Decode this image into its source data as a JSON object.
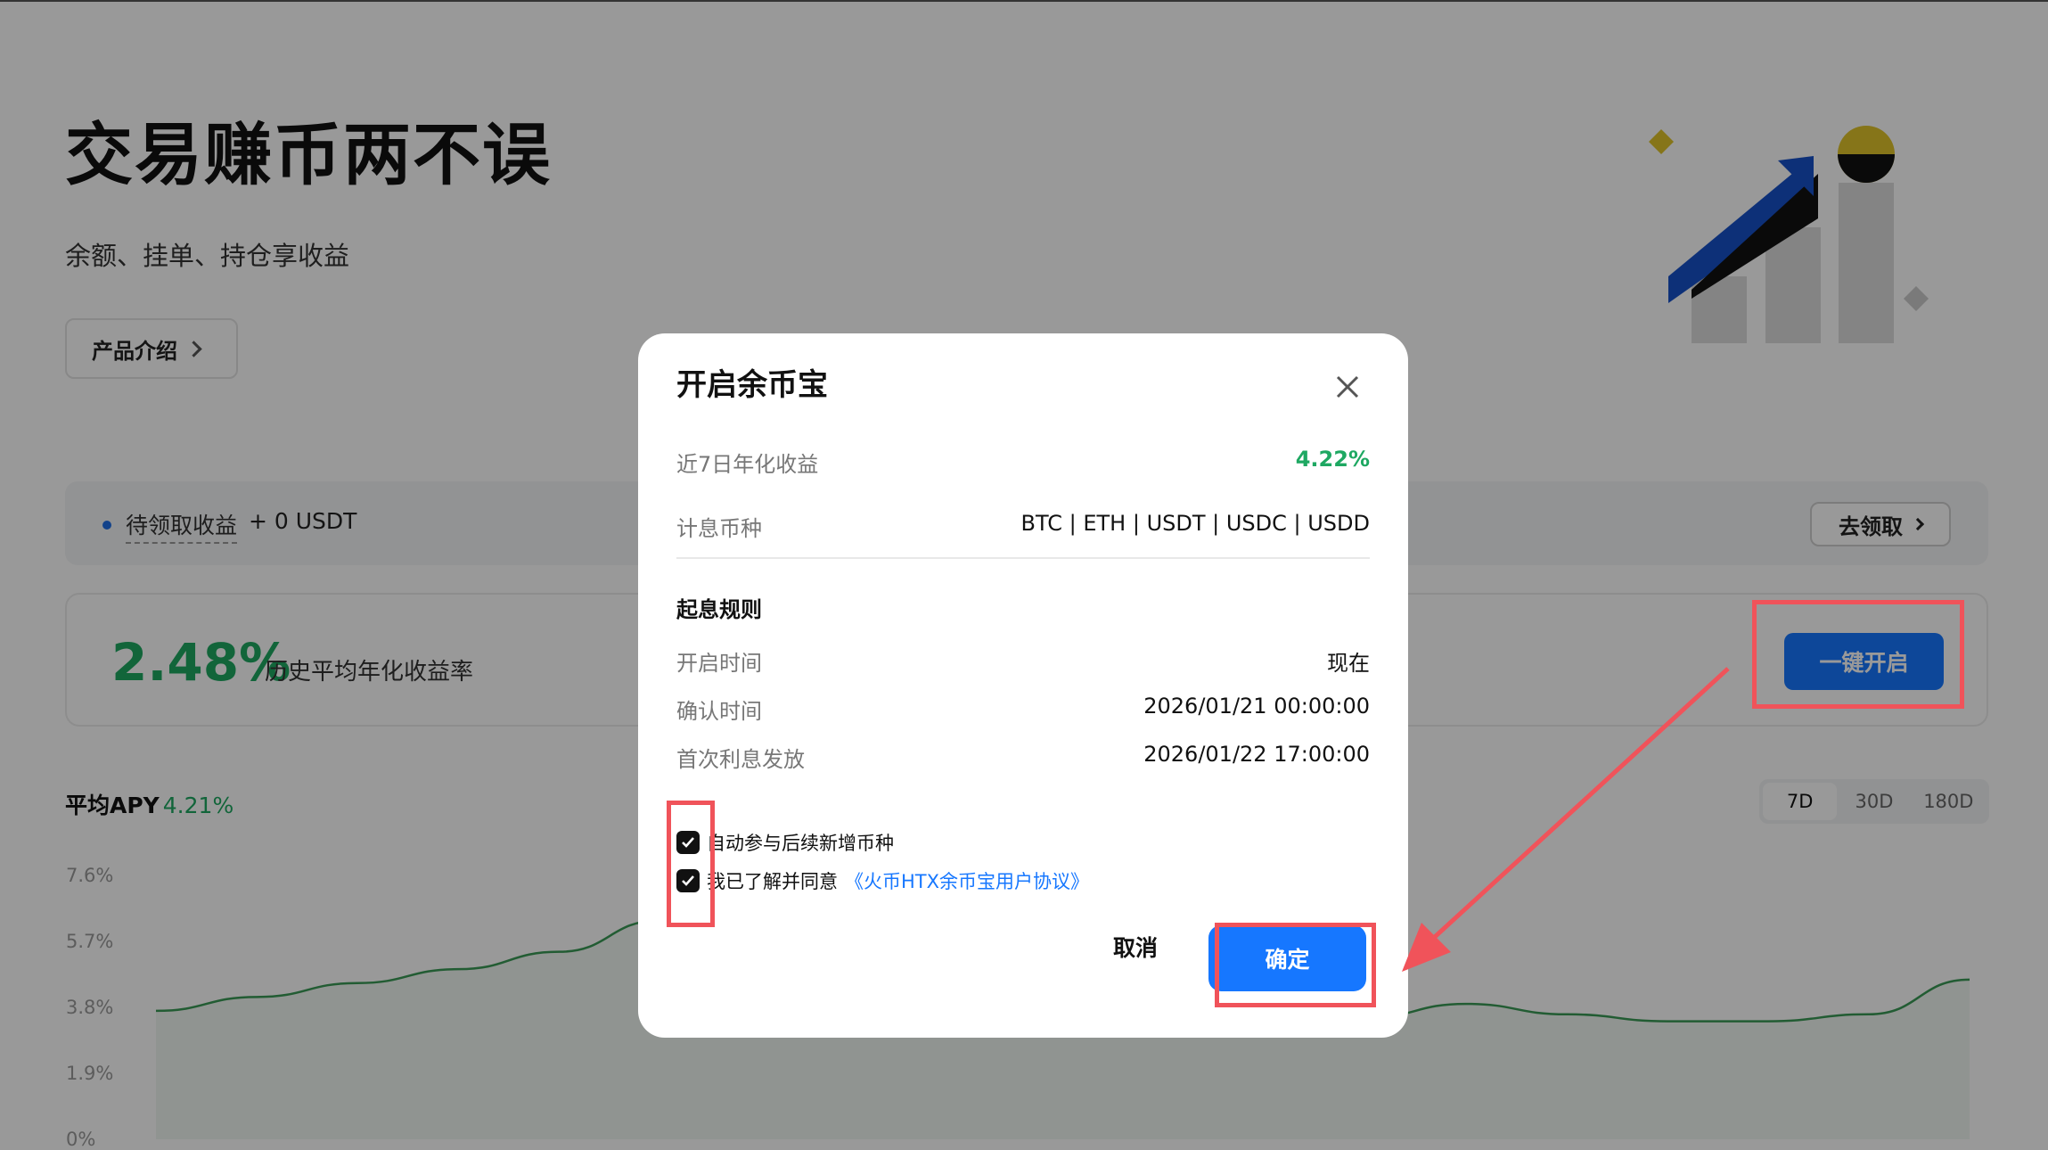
{
  "hero": {
    "title": "交易赚币两不误",
    "subtitle": "余额、挂单、持仓享收益",
    "intro_button": "产品介绍"
  },
  "pending": {
    "label": "待领取收益",
    "value": "+ 0 USDT",
    "claim_button": "去领取"
  },
  "apy_card": {
    "value": "2.48%",
    "label": "历史平均年化收益率",
    "onekey_button": "一键开启"
  },
  "avg_apy": {
    "label": "平均APY",
    "value": "4.21%",
    "tabs": [
      "7D",
      "30D",
      "180D"
    ],
    "active_tab": "7D"
  },
  "chart_data": {
    "type": "area",
    "yticks": [
      "7.6%",
      "5.7%",
      "3.8%",
      "1.9%",
      "0%"
    ],
    "ylim": [
      0,
      7.6
    ],
    "values": [
      3.7,
      4.1,
      4.5,
      4.9,
      5.4,
      6.3,
      7.4,
      7.0,
      6.1,
      4.7,
      3.2,
      3.1,
      3.5,
      3.9,
      3.6,
      3.4,
      3.4,
      3.6,
      4.6
    ],
    "line_color": "#3a9a55",
    "grid": false
  },
  "modal": {
    "title": "开启余币宝",
    "rows": [
      {
        "label": "近7日年化收益",
        "value": "4.22%"
      },
      {
        "label": "计息币种",
        "value": "BTC | ETH | USDT | USDC | USDD"
      }
    ],
    "section_title": "起息规则",
    "rules": [
      {
        "label": "开启时间",
        "value": "现在"
      },
      {
        "label": "确认时间",
        "value": "2026/01/21 00:00:00"
      },
      {
        "label": "首次利息发放",
        "value": "2026/01/22 17:00:00"
      }
    ],
    "check_auto": "自动参与后续新增币种",
    "check_agree_prefix": "我已了解并同意",
    "check_agree_link": "《火币HTX余币宝用户协议》",
    "cancel_button": "取消",
    "confirm_button": "确定"
  },
  "colors": {
    "accent": "#1677ff",
    "green": "#1ea862",
    "highlight": "#f0535a"
  }
}
